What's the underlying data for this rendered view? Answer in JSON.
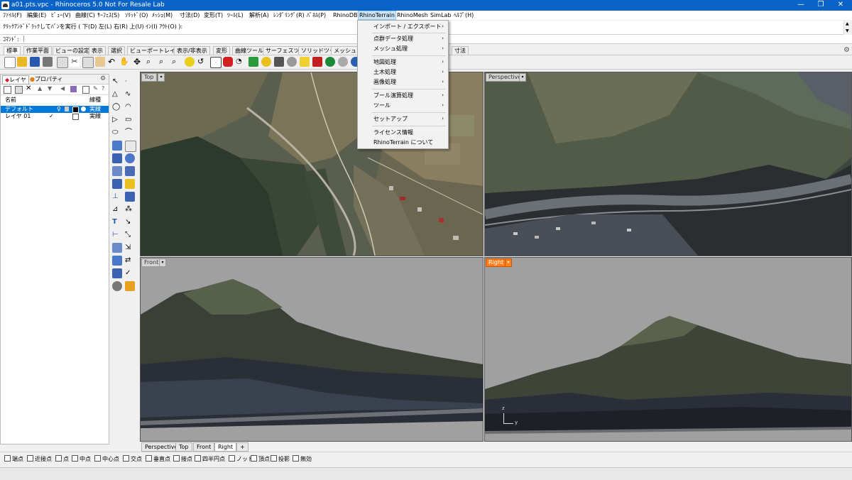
{
  "window": {
    "title": "a01.pts.vpc - Rhinoceros 5.0 Not For Resale Lab",
    "minimize": "—",
    "maximize": "❐",
    "close": "✕"
  },
  "menubar": [
    "ﾌｧｲﾙ(F)",
    "編集(E)",
    "ﾋﾞｭｰ(V)",
    "曲線(C)",
    "ｻｰﾌｪｽ(S)",
    "ｿﾘｯﾄﾞ(O)",
    "ﾒｯｼｭ(M)",
    "寸法(D)",
    "変形(T)",
    "ﾂｰﾙ(L)",
    "解析(A)",
    "ﾚﾝﾀﾞﾘﾝｸﾞ(R)",
    "ﾊﾟﾈﾙ(P)",
    "RhinoDB",
    "RhinoTerrain",
    "RhinoMesh",
    "SimLab",
    "ﾍﾙﾌﾟ(H)"
  ],
  "command_history": "ｸﾘｯｸｱﾝﾄﾞﾄﾞﾗｯｸしてﾊﾟﾝを実行 ( 下(D)  左(L)  右(R)  上(U)  ｲﾝ(I)  ｱｳﾄ(O) ):",
  "command_prompt": "ｺﾏﾝﾄﾞ:",
  "toolbar_tabs": [
    "標準",
    "作業平面",
    "ビューの設定",
    "表示",
    "選択",
    "ビューポートレイアウト",
    "表示/非表示",
    "変形",
    "曲線ツール",
    "サーフェスツール",
    "ソリッドツール",
    "メッシュツール"
  ],
  "toolbar_tab_tail": "寸法",
  "dropdown": {
    "items": [
      {
        "label": "インポート / エクスポート",
        "arrow": "›"
      },
      {
        "label": "点群データ処理",
        "arrow": "›"
      },
      {
        "label": "メッシュ処理",
        "arrow": "›"
      },
      {
        "label": "地図処理",
        "arrow": "›"
      },
      {
        "label": "土木処理",
        "arrow": "›"
      },
      {
        "label": "画像処理",
        "arrow": "›"
      },
      {
        "label": "ブール演算処理",
        "arrow": "›"
      },
      {
        "label": "ツール",
        "arrow": "›"
      },
      {
        "label": "セットアップ",
        "arrow": "›"
      },
      {
        "label": "ライセンス情報",
        "arrow": ""
      },
      {
        "label": "RhinoTerrain について",
        "arrow": ""
      }
    ]
  },
  "layer_panel": {
    "tabs": [
      "レイヤ",
      "プロパティ"
    ],
    "header_name": "名前",
    "header_linetype": "線種",
    "rows": [
      {
        "name": "デフォルト",
        "linetype": "実線",
        "current": "✓"
      },
      {
        "name": "レイヤ 01",
        "linetype": "実線",
        "current": "✓"
      }
    ]
  },
  "viewports": {
    "top": "Top",
    "perspective": "Perspective",
    "front": "Front",
    "right": "Right"
  },
  "viewport_tabs": [
    "Perspective",
    "Top",
    "Front",
    "Right"
  ],
  "viewport_tab_add": "+",
  "osnaps": [
    "端点",
    "近接点",
    "点",
    "中点",
    "中心点",
    "交点",
    "垂直点",
    "接点",
    "四半円点",
    "ノット",
    "頂点",
    "投影",
    "無効"
  ],
  "axis": {
    "z": "z",
    "y": "y"
  },
  "colors": {
    "title_bar": "#0a64c8",
    "active_viewport_label": "#ff7e1a",
    "selected_layer_row": "#0078d7",
    "viewport_background": "#a0a0a0"
  }
}
